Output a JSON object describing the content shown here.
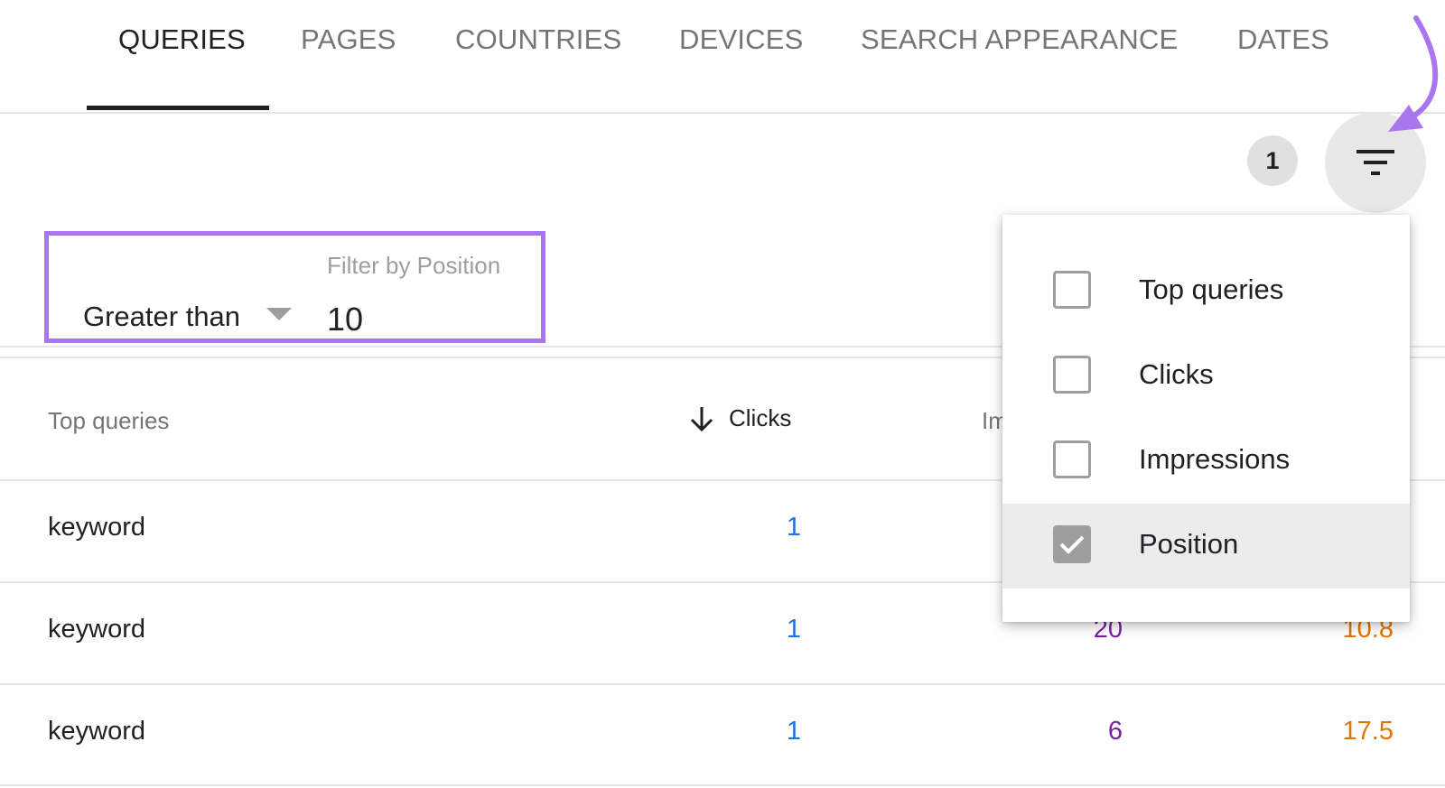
{
  "tabs": [
    {
      "label": "QUERIES",
      "active": true
    },
    {
      "label": "PAGES",
      "active": false
    },
    {
      "label": "COUNTRIES",
      "active": false
    },
    {
      "label": "DEVICES",
      "active": false
    },
    {
      "label": "SEARCH APPEARANCE",
      "active": false
    },
    {
      "label": "DATES",
      "active": false
    }
  ],
  "toolbar": {
    "active_filter_count": "1",
    "filter_icon": "filter-list-icon"
  },
  "filter": {
    "label": "Filter by Position",
    "operator": "Greater than",
    "value": "10"
  },
  "table": {
    "columns": {
      "query": "Top queries",
      "clicks": "Clicks",
      "impressions": "Im"
    },
    "rows": [
      {
        "query": "keyword",
        "clicks": "1",
        "impressions": "",
        "position": ""
      },
      {
        "query": "keyword",
        "clicks": "1",
        "impressions": "20",
        "position": "10.8"
      },
      {
        "query": "keyword",
        "clicks": "1",
        "impressions": "6",
        "position": "17.5"
      }
    ]
  },
  "filter_menu": {
    "items": [
      {
        "label": "Top queries",
        "checked": false
      },
      {
        "label": "Clicks",
        "checked": false
      },
      {
        "label": "Impressions",
        "checked": false
      },
      {
        "label": "Position",
        "checked": true
      }
    ]
  },
  "colors": {
    "highlight": "#a877f0",
    "clicks": "#1a73e8",
    "impressions": "#7b1fa2",
    "position": "#e37400"
  }
}
